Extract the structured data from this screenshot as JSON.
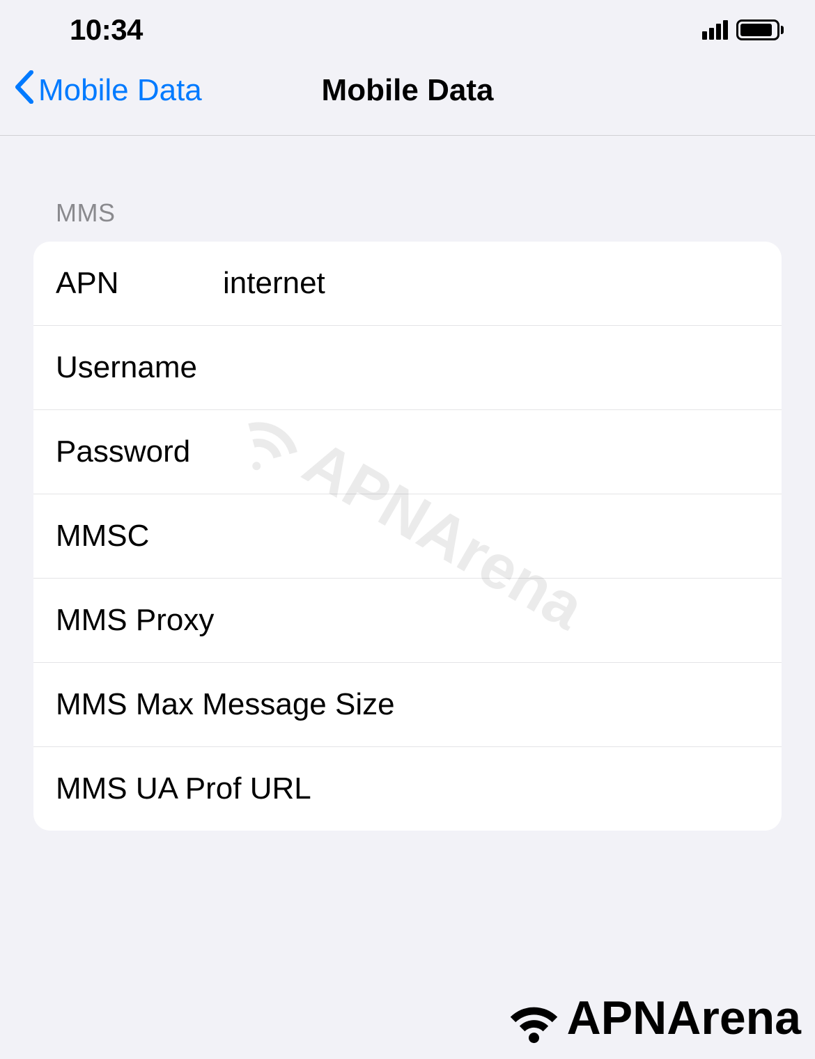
{
  "statusBar": {
    "time": "10:34"
  },
  "navBar": {
    "backLabel": "Mobile Data",
    "title": "Mobile Data"
  },
  "mms": {
    "sectionHeader": "MMS",
    "rows": [
      {
        "label": "APN",
        "value": "internet"
      },
      {
        "label": "Username",
        "value": ""
      },
      {
        "label": "Password",
        "value": ""
      },
      {
        "label": "MMSC",
        "value": ""
      },
      {
        "label": "MMS Proxy",
        "value": ""
      },
      {
        "label": "MMS Max Message Size",
        "value": ""
      },
      {
        "label": "MMS UA Prof URL",
        "value": ""
      }
    ]
  },
  "watermark": {
    "text": "APNArena"
  }
}
